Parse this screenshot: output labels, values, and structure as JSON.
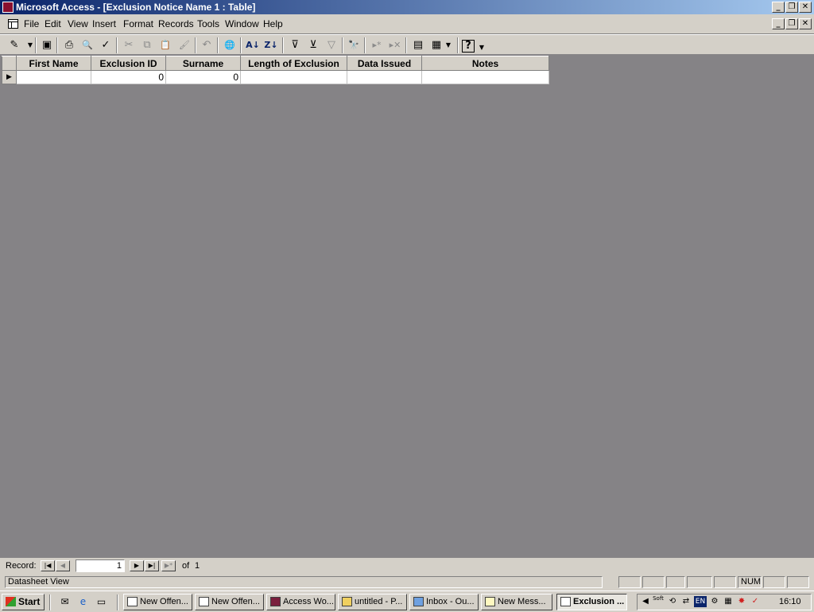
{
  "window": {
    "title": "Microsoft Access - [Exclusion Notice Name 1 : Table]",
    "caption_buttons": [
      "_",
      "❐",
      "✕"
    ]
  },
  "menu": [
    {
      "label": "File"
    },
    {
      "label": "Edit"
    },
    {
      "label": "View"
    },
    {
      "label": "Insert"
    },
    {
      "label": "Format"
    },
    {
      "label": "Records"
    },
    {
      "label": "Tools"
    },
    {
      "label": "Window"
    },
    {
      "label": "Help"
    }
  ],
  "toolbar": {
    "icons": [
      "design-view-icon",
      "save-icon",
      "print-icon",
      "print-preview-icon",
      "spelling-icon",
      "cut-icon",
      "copy-icon",
      "paste-icon",
      "format-painter-icon",
      "undo-icon",
      "hyperlink-icon",
      "sort-ascending-icon",
      "sort-descending-icon",
      "filter-by-selection-icon",
      "filter-by-form-icon",
      "apply-filter-icon",
      "find-icon",
      "new-record-icon",
      "delete-record-icon",
      "database-window-icon",
      "new-object-icon",
      "help-icon"
    ],
    "glyphs": {
      "design": "✎",
      "save": "▣",
      "print": "⎙",
      "preview": "🔍",
      "spell": "✓",
      "cut": "✂",
      "copy": "⧉",
      "paste": "📋",
      "painter": "🖌",
      "undo": "↶",
      "hyperlink": "🌐",
      "sort_asc": "A↓",
      "sort_desc": "Z↓",
      "filter_sel": "⊽",
      "filter_form": "⊻",
      "filter": "▽",
      "find": "🔭",
      "new_rec": "▸*",
      "del_rec": "▸✕",
      "db_window": "▤",
      "new_obj": "▦",
      "help": "?"
    }
  },
  "table": {
    "columns": [
      "First Name",
      "Exclusion ID",
      "Surname",
      "Length of Exclusion",
      "Data Issued",
      "Notes"
    ],
    "rows": [
      {
        "selector": "▶",
        "cells": [
          "",
          "0",
          "0",
          "",
          "",
          ""
        ]
      }
    ]
  },
  "record_nav": {
    "label": "Record:",
    "current": "1",
    "of_label": "of",
    "total": "1",
    "buttons": [
      "|◀",
      "◀",
      "▶",
      "▶|",
      "▶*"
    ]
  },
  "status": {
    "text": "Datasheet View",
    "num": "NUM"
  },
  "taskbar": {
    "start_label": "Start",
    "buttons": [
      {
        "label": "New Offen..."
      },
      {
        "label": "New Offen..."
      },
      {
        "label": "Access Wo..."
      },
      {
        "label": "untitled - P..."
      },
      {
        "label": "Inbox - Ou..."
      },
      {
        "label": "New Mess..."
      },
      {
        "label": "Exclusion ..."
      }
    ],
    "active_index": 6,
    "tray_text": {
      "lang": "EN",
      "soft": "Soft"
    },
    "clock": "16:10"
  },
  "colors": {
    "title_start": "#0a246a",
    "title_end": "#a6caf0",
    "workspace": "#858386",
    "chrome": "#d4d0c8"
  }
}
